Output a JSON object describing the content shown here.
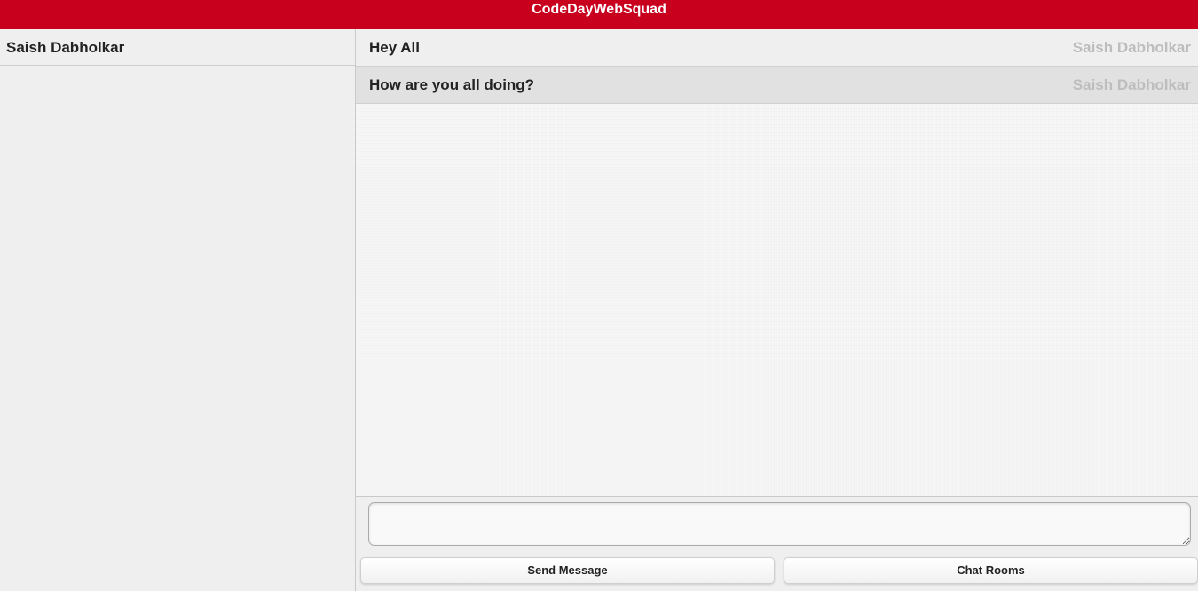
{
  "header": {
    "title": "CodeDayWebSquad"
  },
  "sidebar": {
    "users": [
      {
        "name": "Saish Dabholkar"
      }
    ]
  },
  "messages": [
    {
      "text": "Hey All",
      "author": "Saish Dabholkar"
    },
    {
      "text": "How are you all doing?",
      "author": "Saish Dabholkar"
    }
  ],
  "composer": {
    "input_value": "",
    "input_placeholder": "",
    "send_label": "Send Message",
    "rooms_label": "Chat Rooms"
  },
  "colors": {
    "brand": "#c8001e",
    "author_text": "#bdbdbd"
  }
}
